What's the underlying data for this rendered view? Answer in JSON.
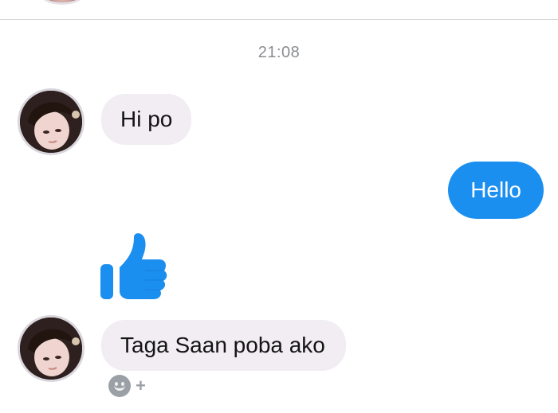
{
  "conversation": {
    "timestamp": "21:08",
    "messages": [
      {
        "from": "contact",
        "text": "Hi po"
      },
      {
        "from": "me",
        "text": "Hello"
      },
      {
        "from": "contact",
        "type": "sticker",
        "icon": "thumbs-up-icon"
      },
      {
        "from": "contact",
        "text": "Taga Saan poba ako"
      }
    ],
    "reaction_add": {
      "icon": "smiley-icon",
      "plus": "+"
    }
  },
  "colors": {
    "outgoing_bubble": "#1b8ff0",
    "incoming_bubble": "#f1edf3",
    "like_blue": "#1b8ff0",
    "timestamp": "#8a8d91"
  }
}
